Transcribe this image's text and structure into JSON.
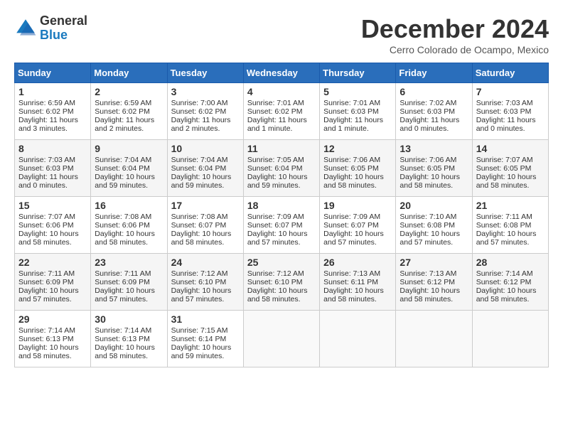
{
  "header": {
    "logo_general": "General",
    "logo_blue": "Blue",
    "month_title": "December 2024",
    "location": "Cerro Colorado de Ocampo, Mexico"
  },
  "days_of_week": [
    "Sunday",
    "Monday",
    "Tuesday",
    "Wednesday",
    "Thursday",
    "Friday",
    "Saturday"
  ],
  "weeks": [
    [
      {
        "day": "1",
        "sunrise": "6:59 AM",
        "sunset": "6:02 PM",
        "daylight": "11 hours and 3 minutes."
      },
      {
        "day": "2",
        "sunrise": "6:59 AM",
        "sunset": "6:02 PM",
        "daylight": "11 hours and 2 minutes."
      },
      {
        "day": "3",
        "sunrise": "7:00 AM",
        "sunset": "6:02 PM",
        "daylight": "11 hours and 2 minutes."
      },
      {
        "day": "4",
        "sunrise": "7:01 AM",
        "sunset": "6:02 PM",
        "daylight": "11 hours and 1 minute."
      },
      {
        "day": "5",
        "sunrise": "7:01 AM",
        "sunset": "6:03 PM",
        "daylight": "11 hours and 1 minute."
      },
      {
        "day": "6",
        "sunrise": "7:02 AM",
        "sunset": "6:03 PM",
        "daylight": "11 hours and 0 minutes."
      },
      {
        "day": "7",
        "sunrise": "7:03 AM",
        "sunset": "6:03 PM",
        "daylight": "11 hours and 0 minutes."
      }
    ],
    [
      {
        "day": "8",
        "sunrise": "7:03 AM",
        "sunset": "6:03 PM",
        "daylight": "11 hours and 0 minutes."
      },
      {
        "day": "9",
        "sunrise": "7:04 AM",
        "sunset": "6:04 PM",
        "daylight": "10 hours and 59 minutes."
      },
      {
        "day": "10",
        "sunrise": "7:04 AM",
        "sunset": "6:04 PM",
        "daylight": "10 hours and 59 minutes."
      },
      {
        "day": "11",
        "sunrise": "7:05 AM",
        "sunset": "6:04 PM",
        "daylight": "10 hours and 59 minutes."
      },
      {
        "day": "12",
        "sunrise": "7:06 AM",
        "sunset": "6:05 PM",
        "daylight": "10 hours and 58 minutes."
      },
      {
        "day": "13",
        "sunrise": "7:06 AM",
        "sunset": "6:05 PM",
        "daylight": "10 hours and 58 minutes."
      },
      {
        "day": "14",
        "sunrise": "7:07 AM",
        "sunset": "6:05 PM",
        "daylight": "10 hours and 58 minutes."
      }
    ],
    [
      {
        "day": "15",
        "sunrise": "7:07 AM",
        "sunset": "6:06 PM",
        "daylight": "10 hours and 58 minutes."
      },
      {
        "day": "16",
        "sunrise": "7:08 AM",
        "sunset": "6:06 PM",
        "daylight": "10 hours and 58 minutes."
      },
      {
        "day": "17",
        "sunrise": "7:08 AM",
        "sunset": "6:07 PM",
        "daylight": "10 hours and 58 minutes."
      },
      {
        "day": "18",
        "sunrise": "7:09 AM",
        "sunset": "6:07 PM",
        "daylight": "10 hours and 57 minutes."
      },
      {
        "day": "19",
        "sunrise": "7:09 AM",
        "sunset": "6:07 PM",
        "daylight": "10 hours and 57 minutes."
      },
      {
        "day": "20",
        "sunrise": "7:10 AM",
        "sunset": "6:08 PM",
        "daylight": "10 hours and 57 minutes."
      },
      {
        "day": "21",
        "sunrise": "7:11 AM",
        "sunset": "6:08 PM",
        "daylight": "10 hours and 57 minutes."
      }
    ],
    [
      {
        "day": "22",
        "sunrise": "7:11 AM",
        "sunset": "6:09 PM",
        "daylight": "10 hours and 57 minutes."
      },
      {
        "day": "23",
        "sunrise": "7:11 AM",
        "sunset": "6:09 PM",
        "daylight": "10 hours and 57 minutes."
      },
      {
        "day": "24",
        "sunrise": "7:12 AM",
        "sunset": "6:10 PM",
        "daylight": "10 hours and 57 minutes."
      },
      {
        "day": "25",
        "sunrise": "7:12 AM",
        "sunset": "6:10 PM",
        "daylight": "10 hours and 58 minutes."
      },
      {
        "day": "26",
        "sunrise": "7:13 AM",
        "sunset": "6:11 PM",
        "daylight": "10 hours and 58 minutes."
      },
      {
        "day": "27",
        "sunrise": "7:13 AM",
        "sunset": "6:12 PM",
        "daylight": "10 hours and 58 minutes."
      },
      {
        "day": "28",
        "sunrise": "7:14 AM",
        "sunset": "6:12 PM",
        "daylight": "10 hours and 58 minutes."
      }
    ],
    [
      {
        "day": "29",
        "sunrise": "7:14 AM",
        "sunset": "6:13 PM",
        "daylight": "10 hours and 58 minutes."
      },
      {
        "day": "30",
        "sunrise": "7:14 AM",
        "sunset": "6:13 PM",
        "daylight": "10 hours and 58 minutes."
      },
      {
        "day": "31",
        "sunrise": "7:15 AM",
        "sunset": "6:14 PM",
        "daylight": "10 hours and 59 minutes."
      },
      null,
      null,
      null,
      null
    ]
  ]
}
